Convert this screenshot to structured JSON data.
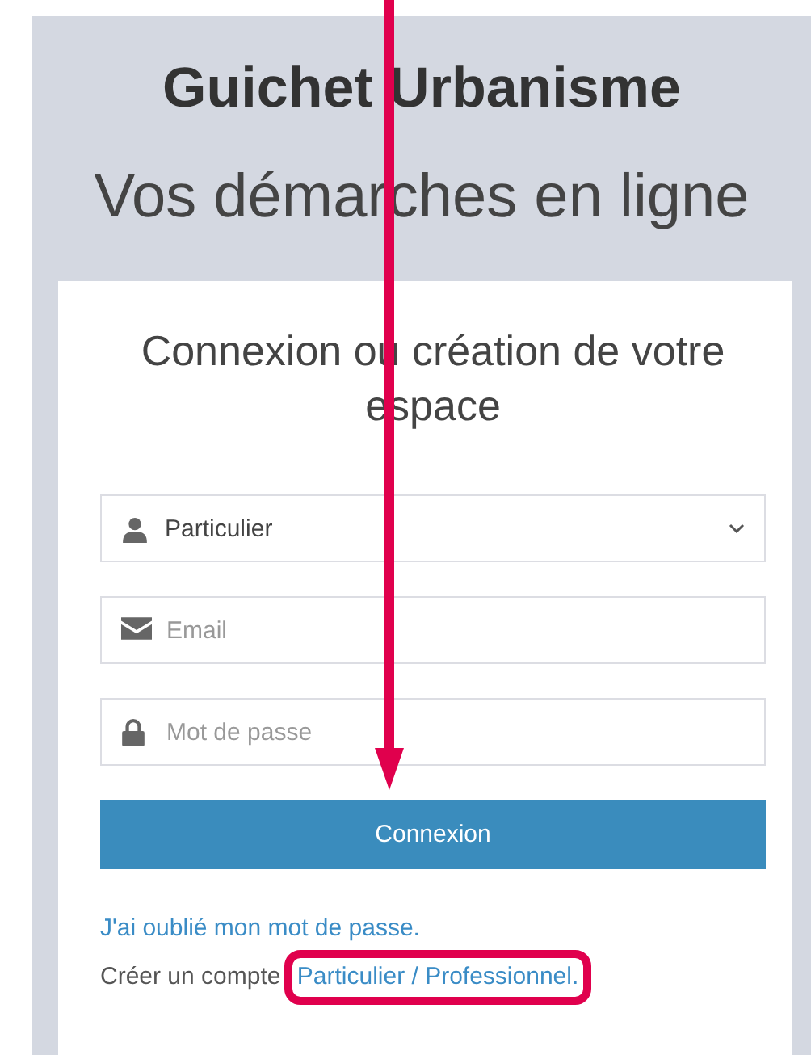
{
  "header": {
    "title": "Guichet Urbanisme",
    "subtitle": "Vos démarches en ligne"
  },
  "login_card": {
    "heading": "Connexion ou création de votre espace",
    "account_type": {
      "value": "Particulier"
    },
    "fields": [
      {
        "kind": "email",
        "placeholder": "Email"
      },
      {
        "kind": "password",
        "placeholder": "Mot de passe"
      }
    ],
    "submit_button": "Connexion",
    "forgot_link": "J'ai oublié mon mot de passe.",
    "create_prefix": "Créer un compte",
    "create_link": "Particulier / Professionnel."
  }
}
